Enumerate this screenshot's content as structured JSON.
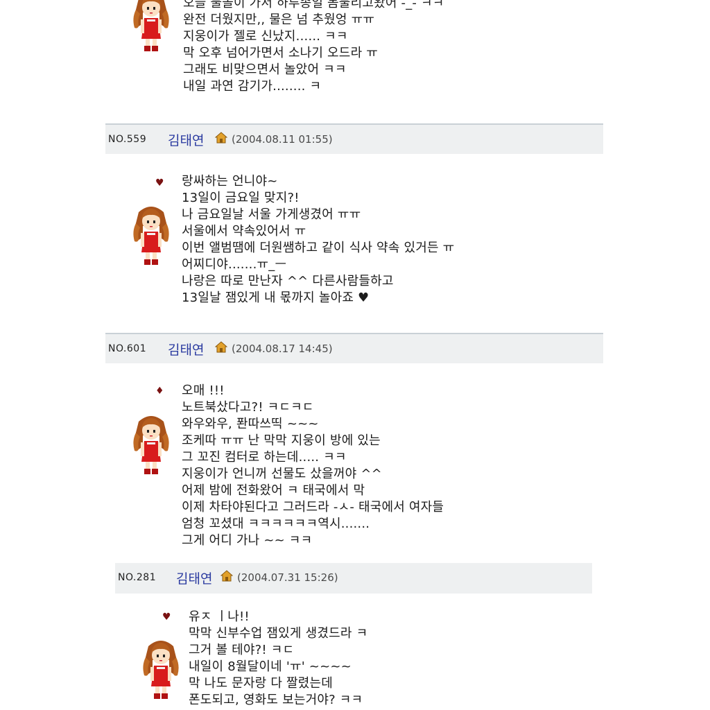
{
  "posts": [
    {
      "lines": [
        "오늘 물놀이 가서 하루종일 몸불리고왔어 -_- ㅋㅋ",
        "완전 더웠지만,, 물은 넘 추웠엉 ㅠㅠ",
        "지웅이가 젤로 신났지...... ㅋㅋ",
        "막 오후 넘어가면서 소나기 오드라 ㅠ",
        "그래도 비맞으면서 놀았어 ㅋㅋ",
        "내일 과연 감기가........ ㅋ"
      ]
    },
    {
      "no": "NO.559",
      "author": "김태연",
      "date": "(2004.08.11 01:55)",
      "mark": "♥",
      "lines": [
        "랑싸하는 언니야~",
        "13일이 금요일 맞지?!",
        "나 금요일날 서울 가게생겼어 ㅠㅠ",
        "서울에서 약속있어서 ㅠ",
        "이번 앨범땜에 더원쌤하고 같이 식사 약속 있거든 ㅠ",
        "어찌디야.......ㅠ_ㅡ",
        "나랑은 따로 만난자 ^^ 다른사람들하고",
        "13일날 잼있게 내 몫까지 놀아죠 ♥"
      ]
    },
    {
      "no": "NO.601",
      "author": "김태연",
      "date": "(2004.08.17 14:45)",
      "mark": "♦",
      "lines": [
        "오매 !!!",
        "노트북샀다고?! ㅋㄷㅋㄷ",
        "와우와우, 퐌따쓰띡 ~~~",
        "조케따 ㅠㅠ 난 막막 지웅이 방에 있는",
        "그 꼬진 컴터로 하는데..... ㅋㅋ",
        "지웅이가 언니꺼 선물도 샀을꺼야 ^^",
        "어제 밤에 전화왔어 ㅋ 태국에서 막",
        "이제 차타야된다고 그러드라 -ㅅ- 태국에서 여자들",
        "엄청 꼬셨대 ㅋㅋㅋㅋㅋㅋ역시.......",
        "그게 어디 가나 ~~ ㅋㅋ"
      ]
    },
    {
      "no": "NO.281",
      "author": "김태연",
      "date": "(2004.07.31 15:26)",
      "mark": "♥",
      "lines": [
        "유ㅈ        ㅣ나!!",
        "막막 신부수업 잼있게 생겼드라 ㅋ",
        "그거 볼 테야?! ㅋㄷ",
        "내일이 8월달이네 'ㅠ' ~~~~",
        "막 나도 문자랑 다 짤렸는데",
        "폰도되고, 영화도 보는거야? ㅋㅋ"
      ]
    }
  ]
}
